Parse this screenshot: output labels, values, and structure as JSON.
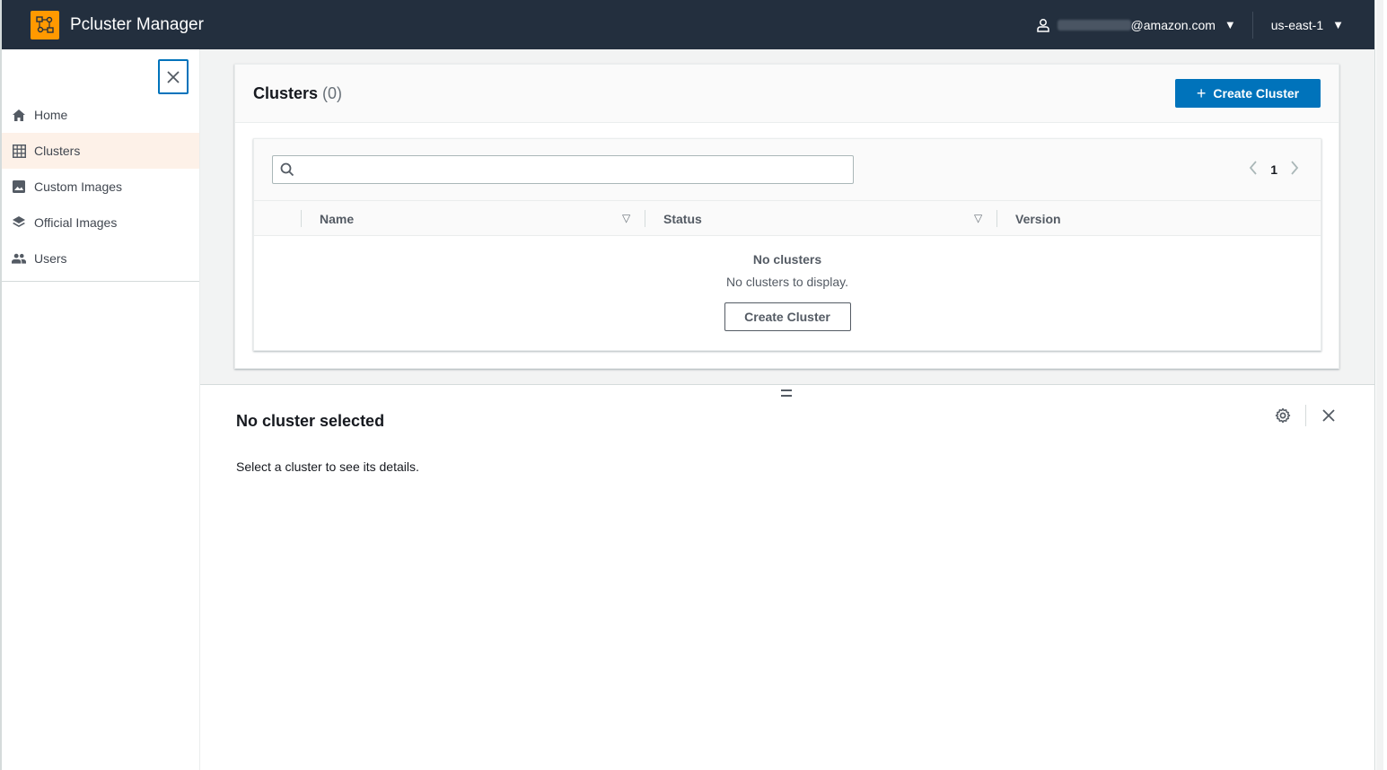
{
  "app": {
    "title": "Pcluster Manager",
    "user_email_suffix": "@amazon.com",
    "region": "us-east-1"
  },
  "sidebar": {
    "items": [
      {
        "label": "Home",
        "icon": "home-icon",
        "active": false
      },
      {
        "label": "Clusters",
        "icon": "grid-icon",
        "active": true
      },
      {
        "label": "Custom Images",
        "icon": "image-icon",
        "active": false
      },
      {
        "label": "Official Images",
        "icon": "layers-icon",
        "active": false
      },
      {
        "label": "Users",
        "icon": "users-icon",
        "active": false
      }
    ]
  },
  "clusters": {
    "title": "Clusters",
    "count": "(0)",
    "create_button": "Create Cluster",
    "search_value": "",
    "page": "1",
    "columns": [
      "Name",
      "Status",
      "Version"
    ],
    "empty_title": "No clusters",
    "empty_desc": "No clusters to display.",
    "empty_button": "Create Cluster"
  },
  "split_panel": {
    "title": "No cluster selected",
    "description": "Select a cluster to see its details."
  },
  "colors": {
    "nav_bg": "#232f3e",
    "accent": "#0073bb",
    "logo": "#ff9900",
    "active_item_bg": "#fdf1e8"
  }
}
